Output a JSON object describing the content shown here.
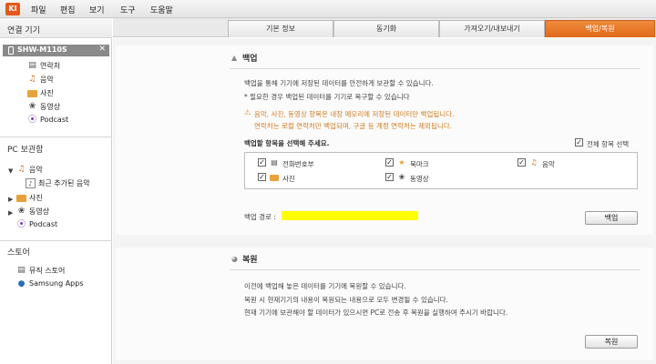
{
  "menubar": {
    "logo": "KI",
    "items": [
      "파일",
      "편집",
      "보기",
      "도구",
      "도움말"
    ]
  },
  "sidebar": {
    "connected_header": "연결 기기",
    "device_name": "SHW-M110S",
    "device_close": "✕",
    "device_items": [
      {
        "label": "연락처",
        "icon": "contacts-icon"
      },
      {
        "label": "음악",
        "icon": "music-icon"
      },
      {
        "label": "사진",
        "icon": "photo-icon"
      },
      {
        "label": "동영상",
        "icon": "video-icon"
      },
      {
        "label": "Podcast",
        "icon": "podcast-icon"
      }
    ],
    "pc_header": "PC 보관함",
    "pc_items": [
      {
        "label": "음악",
        "icon": "music-icon"
      },
      {
        "label": "최근 추가된 음악",
        "icon": "note-icon"
      },
      {
        "label": "사진",
        "icon": "photo-icon"
      },
      {
        "label": "동영상",
        "icon": "video-icon"
      },
      {
        "label": "Podcast",
        "icon": "podcast-icon"
      }
    ],
    "store_header": "스토어",
    "store_items": [
      {
        "label": "뮤직 스토어",
        "icon": "music-store-icon"
      },
      {
        "label": "Samsung Apps",
        "icon": "samsung-apps-icon"
      }
    ]
  },
  "tabs": [
    "기본 정보",
    "동기화",
    "가져오기/내보내기",
    "백업/복원"
  ],
  "active_tab": "백업/복원",
  "backup": {
    "title": "백업",
    "desc1": "백업을 통해 기기에 저장된 데이터를 안전하게 보관할 수 있습니다.",
    "desc2": "* 필요한 경우 백업된 데이터를 기기로 복구할 수 있습니다",
    "warn1": "음악, 사진, 동영상 항목은 내장 메모리에 저장된 데이터만 백업됩니다.",
    "warn2": "연락처는 로컬 연락처만 백업되며, 구글 등 계정 연락처는 제외됩니다.",
    "select_prompt": "백업할 항목을 선택해 주세요.",
    "select_all": "전체 항목 선택",
    "items": [
      {
        "label": "전화번호부",
        "icon": "phonebook-icon"
      },
      {
        "label": "북마크",
        "icon": "bookmark-icon"
      },
      {
        "label": "음악",
        "icon": "music-icon"
      },
      {
        "label": "사진",
        "icon": "photo-icon"
      },
      {
        "label": "동영상",
        "icon": "video-icon"
      }
    ],
    "path_label": "백업 경로 :",
    "button": "백업"
  },
  "restore": {
    "title": "복원",
    "desc1": "이전에 백업해 놓은 데이터를 기기에 복원할 수 있습니다.",
    "desc2": "복원 시 현재기기의 내용이 복원되는 내용으로 모두 변경될 수 있습니다.",
    "desc3": "현재 기기에 보관해야 할 데이터가 있으시면 PC로 전송 후 복원을 실행하여 주시기 바랍니다.",
    "button": "복원"
  },
  "colors": {
    "accent": "#e8761f",
    "warning": "#d17b1f",
    "highlight": "#ffff00"
  }
}
